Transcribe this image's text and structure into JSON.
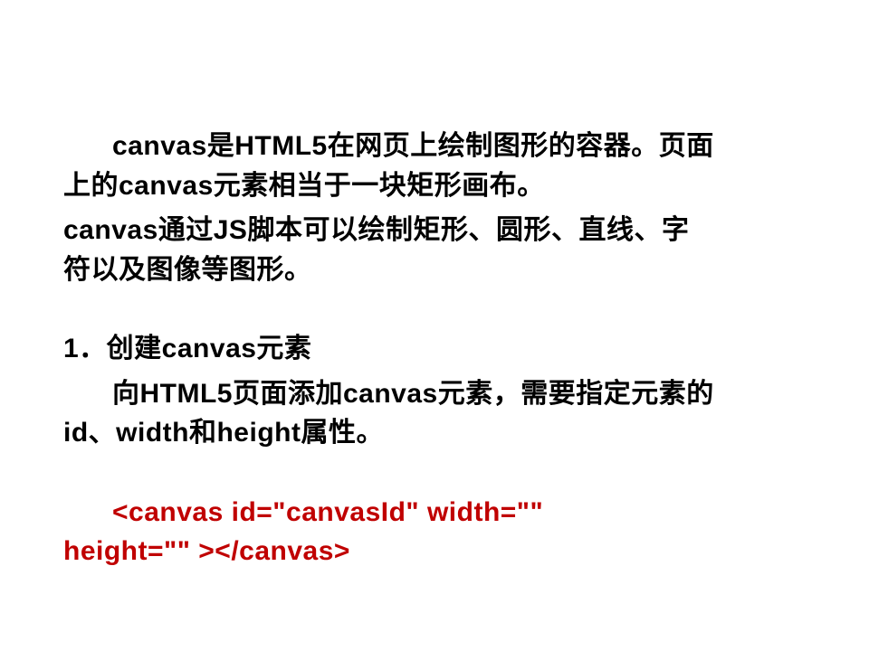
{
  "p1_line1": "canvas是HTML5在网页上绘制图形的容器。页面",
  "p1_line2": "上的canvas元素相当于一块矩形画布。",
  "p2_line1": "canvas通过JS脚本可以绘制矩形、圆形、直线、字",
  "p2_line2": "符以及图像等图形。",
  "p3": "1．创建canvas元素",
  "p4_line1": "向HTML5页面添加canvas元素，需要指定元素的",
  "p4_line2": "id、width和height属性。",
  "code_line1": "<canvas id=\"canvasId\" width=\"\"",
  "code_line2": "height=\"\" ></canvas>"
}
